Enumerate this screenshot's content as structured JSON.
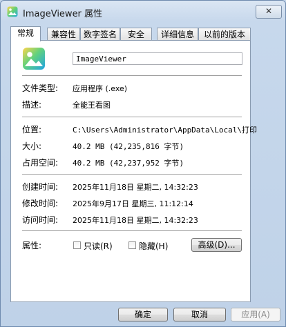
{
  "window": {
    "title": "ImageViewer 属性",
    "close_label": "✕"
  },
  "tabs": [
    {
      "label": "常规",
      "active": true
    },
    {
      "label": "兼容性"
    },
    {
      "label": "数字签名"
    },
    {
      "label": "安全"
    },
    {
      "label": "详细信息"
    },
    {
      "label": "以前的版本"
    }
  ],
  "general": {
    "file_name": "ImageViewer",
    "file_type_label": "文件类型:",
    "file_type_value": "应用程序 (.exe)",
    "description_label": "描述:",
    "description_value": "全能王看图",
    "location_label": "位置:",
    "location_value": "C:\\Users\\Administrator\\AppData\\Local\\打印",
    "size_label": "大小:",
    "size_value": "40.2 MB (42,235,816 字节)",
    "disk_size_label": "占用空间:",
    "disk_size_value": "40.2 MB (42,237,952 字节)",
    "created_label": "创建时间:",
    "created_value": "2025年11月18日 星期二, 14:32:23",
    "modified_label": "修改时间:",
    "modified_value": "2025年9月17日 星期三, 11:12:14",
    "accessed_label": "访问时间:",
    "accessed_value": "2025年11月18日 星期二, 14:32:23",
    "attributes_label": "属性:",
    "readonly_label": "只读(R)",
    "hidden_label": "隐藏(H)",
    "advanced_label": "高级(D)..."
  },
  "footer": {
    "ok_label": "确定",
    "cancel_label": "取消",
    "apply_label": "应用(A)"
  }
}
